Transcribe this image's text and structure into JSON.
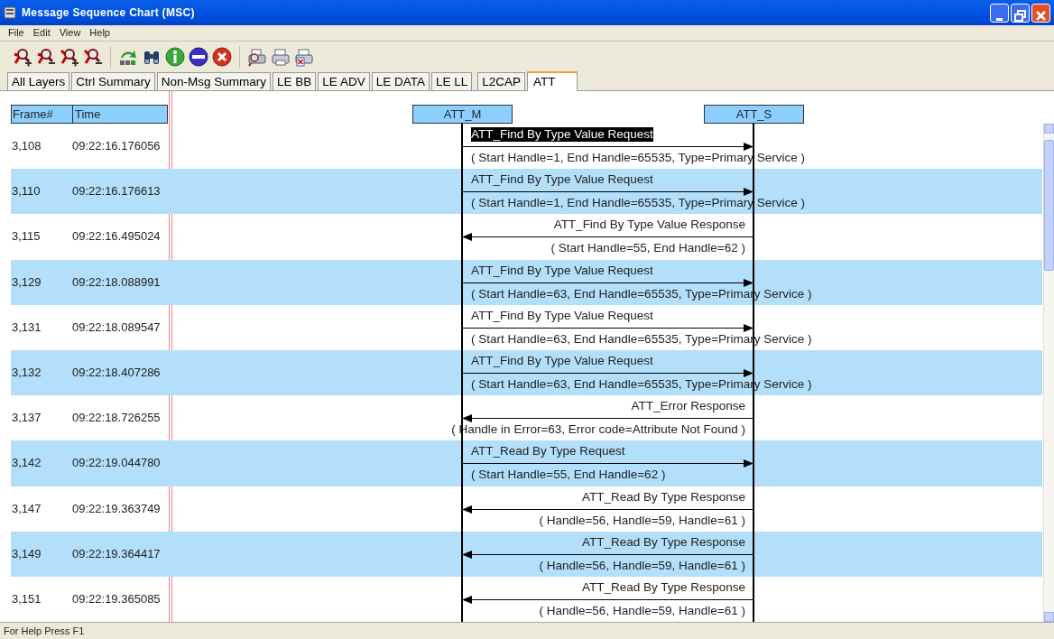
{
  "window": {
    "title": "Message Sequence Chart (MSC)"
  },
  "menu": [
    "File",
    "Edit",
    "View",
    "Help"
  ],
  "tabs": [
    {
      "label": "All Layers",
      "selected": false
    },
    {
      "label": "Ctrl Summary",
      "selected": false
    },
    {
      "label": "Non-Msg Summary",
      "selected": false
    },
    {
      "label": "LE BB",
      "selected": false
    },
    {
      "label": "LE ADV",
      "selected": false
    },
    {
      "label": "LE DATA",
      "selected": false
    },
    {
      "label": "LE LL",
      "selected": false
    },
    {
      "label": "L2CAP",
      "selected": false
    },
    {
      "label": "ATT",
      "selected": true
    }
  ],
  "columns": [
    "Frame#",
    "Time"
  ],
  "lifelines": [
    "ATT_M",
    "ATT_S"
  ],
  "rows": [
    {
      "frame": "3,108",
      "time": "09:22:16.176056",
      "shaded": false,
      "message": {
        "name": "ATT_Find By Type Value Request",
        "params": "( Start Handle=1, End Handle=65535, Type=Primary Service )",
        "kind": "request",
        "selected": true
      }
    },
    {
      "frame": "3,110",
      "time": "09:22:16.176613",
      "shaded": true,
      "message": {
        "name": "ATT_Find By Type Value Request",
        "params": "( Start Handle=1, End Handle=65535, Type=Primary Service )",
        "kind": "request",
        "selected": false
      }
    },
    {
      "frame": "3,115",
      "time": "09:22:16.495024",
      "shaded": false,
      "message": {
        "name": "ATT_Find By Type Value Response",
        "params": "( Start Handle=55, End Handle=62 )",
        "kind": "response",
        "selected": false
      }
    },
    {
      "frame": "3,129",
      "time": "09:22:18.088991",
      "shaded": true,
      "message": {
        "name": "ATT_Find By Type Value Request",
        "params": "( Start Handle=63, End Handle=65535, Type=Primary Service )",
        "kind": "request",
        "selected": false
      }
    },
    {
      "frame": "3,131",
      "time": "09:22:18.089547",
      "shaded": false,
      "message": {
        "name": "ATT_Find By Type Value Request",
        "params": "( Start Handle=63, End Handle=65535, Type=Primary Service )",
        "kind": "request",
        "selected": false
      }
    },
    {
      "frame": "3,132",
      "time": "09:22:18.407286",
      "shaded": true,
      "message": {
        "name": "ATT_Find By Type Value Request",
        "params": "( Start Handle=63, End Handle=65535, Type=Primary Service )",
        "kind": "request",
        "selected": false
      }
    },
    {
      "frame": "3,137",
      "time": "09:22:18.726255",
      "shaded": false,
      "message": {
        "name": "ATT_Error Response",
        "params": "( Handle in Error=63, Error code=Attribute Not Found )",
        "kind": "response",
        "selected": false
      }
    },
    {
      "frame": "3,142",
      "time": "09:22:19.044780",
      "shaded": true,
      "message": {
        "name": "ATT_Read By Type Request",
        "params": "( Start Handle=55, End Handle=62 )",
        "kind": "request",
        "selected": false
      }
    },
    {
      "frame": "3,147",
      "time": "09:22:19.363749",
      "shaded": false,
      "message": {
        "name": "ATT_Read By Type Response",
        "params": "( Handle=56, Handle=59, Handle=61 )",
        "kind": "response",
        "selected": false
      }
    },
    {
      "frame": "3,149",
      "time": "09:22:19.364417",
      "shaded": true,
      "message": {
        "name": "ATT_Read By Type Response",
        "params": "( Handle=56, Handle=59, Handle=61 )",
        "kind": "response",
        "selected": false
      }
    },
    {
      "frame": "3,151",
      "time": "09:22:19.365085",
      "shaded": false,
      "message": {
        "name": "ATT_Read By Type Response",
        "params": "( Handle=56, Handle=59, Handle=61 )",
        "kind": "response",
        "selected": false
      }
    }
  ],
  "status_bar": "For Help Press F1"
}
